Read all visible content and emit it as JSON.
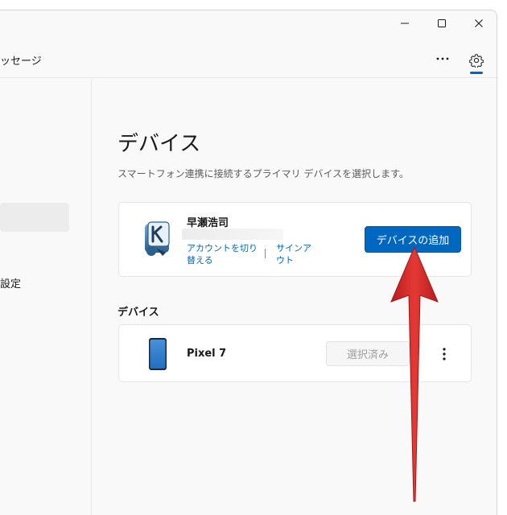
{
  "window": {
    "nav_tab_partial": "ッセージ",
    "minimize_label": "minimize",
    "maximize_label": "maximize",
    "close_label": "close"
  },
  "sidebar": {
    "items": [
      {
        "label": "",
        "selected": true
      },
      {
        "label": "設定",
        "selected": false
      }
    ]
  },
  "main": {
    "title": "デバイス",
    "description": "スマートフォン連携に接続するプライマリ デバイスを選択します。",
    "account": {
      "name": "早瀬浩司",
      "switch_account": "アカウントを切り替える",
      "sign_out": "サインアウト",
      "add_device_button": "デバイスの追加"
    },
    "devices_section_title": "デバイス",
    "devices": [
      {
        "name": "Pixel 7",
        "status_button": "選択済み"
      }
    ]
  },
  "icons": {
    "more": "more-horizontal-icon",
    "settings": "gear-icon",
    "avatar": "user-avatar-icon",
    "device": "phone-icon",
    "device_menu": "more-vertical-icon",
    "annotation": "red-arrow-icon"
  },
  "colors": {
    "accent": "#0067c0",
    "annotation_arrow": "#d32f2f",
    "background": "#f9f9f9",
    "card": "#ffffff"
  }
}
